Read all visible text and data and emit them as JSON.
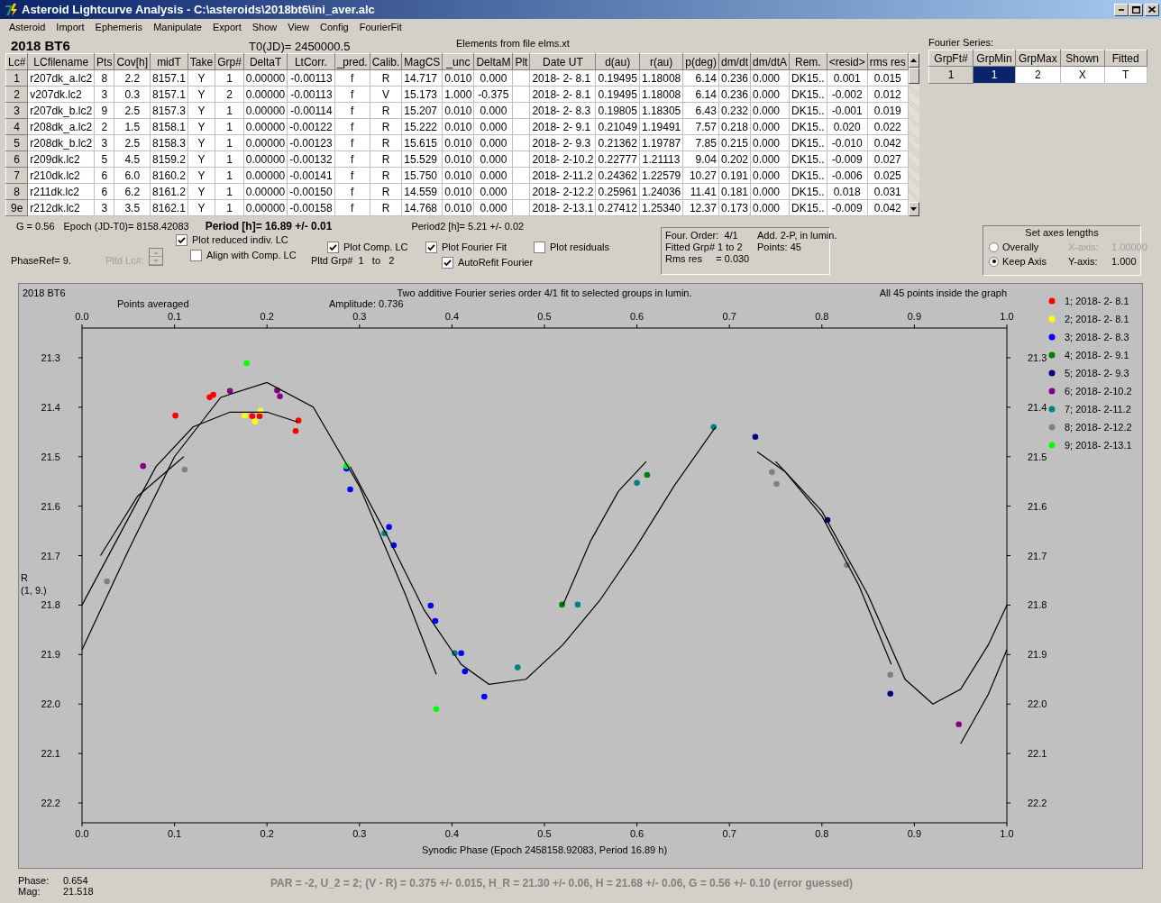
{
  "window": {
    "title": "Asteroid Lightcurve Analysis - C:\\asteroids\\2018bt6\\ini_aver.alc"
  },
  "menu": [
    "Asteroid",
    "Import",
    "Ephemeris",
    "Manipulate",
    "Export",
    "Show",
    "View",
    "Config",
    "FourierFit"
  ],
  "heading": {
    "asteroid": "2018 BT6",
    "t0": "T0(JD)= 2450000.5",
    "elements_note": "Elements from file elms.xt"
  },
  "table": {
    "columns": [
      "Lc#",
      "LCfilename",
      "Pts",
      "Cov[h]",
      "midT",
      "Take",
      "Grp#",
      "DeltaT",
      "LtCorr.",
      "_pred.",
      "Calib.",
      "MagCS",
      "_unc",
      "DeltaM",
      "Plt",
      "Date UT",
      "d(au)",
      "r(au)",
      "p(deg)",
      "dm/dt",
      "dm/dtA",
      "Rem.",
      "<resid>",
      "rms res"
    ],
    "rows": [
      {
        "cells": [
          "1",
          "r207dk_a.lc2",
          "8",
          "2.2",
          "8157.1",
          "Y",
          "1",
          "0.00000",
          "-0.00113",
          "f",
          "R",
          "14.717",
          "0.010",
          "0.000",
          "",
          "2018- 2- 8.1",
          "0.19495",
          "1.18008",
          "6.14",
          "0.236",
          "0.000",
          "DK15..",
          "0.001",
          "0.015"
        ]
      },
      {
        "cells": [
          "2",
          "v207dk.lc2",
          "3",
          "0.3",
          "8157.1",
          "Y",
          "2",
          "0.00000",
          "-0.00113",
          "f",
          "V",
          "15.173",
          "1.000",
          "-0.375",
          "",
          "2018- 2- 8.1",
          "0.19495",
          "1.18008",
          "6.14",
          "0.236",
          "0.000",
          "DK15..",
          "-0.002",
          "0.012"
        ]
      },
      {
        "cells": [
          "3",
          "r207dk_b.lc2",
          "9",
          "2.5",
          "8157.3",
          "Y",
          "1",
          "0.00000",
          "-0.00114",
          "f",
          "R",
          "15.207",
          "0.010",
          "0.000",
          "",
          "2018- 2- 8.3",
          "0.19805",
          "1.18305",
          "6.43",
          "0.232",
          "0.000",
          "DK15..",
          "-0.001",
          "0.019"
        ]
      },
      {
        "cells": [
          "4",
          "r208dk_a.lc2",
          "2",
          "1.5",
          "8158.1",
          "Y",
          "1",
          "0.00000",
          "-0.00122",
          "f",
          "R",
          "15.222",
          "0.010",
          "0.000",
          "",
          "2018- 2- 9.1",
          "0.21049",
          "1.19491",
          "7.57",
          "0.218",
          "0.000",
          "DK15..",
          "0.020",
          "0.022"
        ]
      },
      {
        "cells": [
          "5",
          "r208dk_b.lc2",
          "3",
          "2.5",
          "8158.3",
          "Y",
          "1",
          "0.00000",
          "-0.00123",
          "f",
          "R",
          "15.615",
          "0.010",
          "0.000",
          "",
          "2018- 2- 9.3",
          "0.21362",
          "1.19787",
          "7.85",
          "0.215",
          "0.000",
          "DK15..",
          "-0.010",
          "0.042"
        ]
      },
      {
        "cells": [
          "6",
          "r209dk.lc2",
          "5",
          "4.5",
          "8159.2",
          "Y",
          "1",
          "0.00000",
          "-0.00132",
          "f",
          "R",
          "15.529",
          "0.010",
          "0.000",
          "",
          "2018- 2-10.2",
          "0.22777",
          "1.21113",
          "9.04",
          "0.202",
          "0.000",
          "DK15..",
          "-0.009",
          "0.027"
        ]
      },
      {
        "cells": [
          "7",
          "r210dk.lc2",
          "6",
          "6.0",
          "8160.2",
          "Y",
          "1",
          "0.00000",
          "-0.00141",
          "f",
          "R",
          "15.750",
          "0.010",
          "0.000",
          "",
          "2018- 2-11.2",
          "0.24362",
          "1.22579",
          "10.27",
          "0.191",
          "0.000",
          "DK15..",
          "-0.006",
          "0.025"
        ]
      },
      {
        "cells": [
          "8",
          "r211dk.lc2",
          "6",
          "6.2",
          "8161.2",
          "Y",
          "1",
          "0.00000",
          "-0.00150",
          "f",
          "R",
          "14.559",
          "0.010",
          "0.000",
          "",
          "2018- 2-12.2",
          "0.25961",
          "1.24036",
          "11.41",
          "0.181",
          "0.000",
          "DK15..",
          "0.018",
          "0.031"
        ]
      },
      {
        "cells": [
          "9e",
          "r212dk.lc2",
          "3",
          "3.5",
          "8162.1",
          "Y",
          "1",
          "0.00000",
          "-0.00158",
          "f",
          "R",
          "14.768",
          "0.010",
          "0.000",
          "",
          "2018- 2-13.1",
          "0.27412",
          "1.25340",
          "12.37",
          "0.173",
          "0.000",
          "DK15..",
          "-0.009",
          "0.042"
        ]
      }
    ]
  },
  "fourier_series": {
    "label": "Fourier Series:",
    "columns": [
      "GrpFt#",
      "GrpMin",
      "GrpMax",
      "Shown",
      "Fitted"
    ],
    "rows": [
      {
        "cells": [
          {
            "text": "1",
            "selected": false
          },
          {
            "text": "1",
            "selected": true
          },
          {
            "text": "2",
            "selected": false
          },
          {
            "text": "X",
            "selected": false
          },
          {
            "text": "T",
            "selected": false
          }
        ]
      }
    ]
  },
  "controls": {
    "g": "G = 0.56",
    "epoch": "Epoch (JD-T0)= 8158.42083",
    "period": "Period [h]= 16.89 +/- 0.01",
    "period2": "Period2 [h]= 5.21 +/- 0.02",
    "phase_ref": "PhaseRef= 9.",
    "pltd_lc": {
      "label": "Pltd Lc#:",
      "disabled": true
    },
    "checkboxes": [
      {
        "label": "Plot reduced indiv. LC",
        "checked": true
      },
      {
        "label": "Align with Comp. LC",
        "checked": false
      },
      {
        "label": "Plot Comp. LC",
        "checked": true
      },
      {
        "label": "Plot Fourier Fit",
        "checked": true
      },
      {
        "label": "AutoRefit Fourier",
        "checked": true
      },
      {
        "label": "Plot residuals",
        "checked": false
      }
    ],
    "pltd_grp": "Pltd Grp#  1   to   2"
  },
  "fit_info": [
    "Four. Order:  4/1",
    "Add. 2-P, in lumin.",
    "Fitted Grp# 1 to 2",
    "Points: 45",
    "Rms res     = 0.030"
  ],
  "axes_box": {
    "title": "Set axes lengths",
    "options": [
      {
        "label": "Overally",
        "selected": false,
        "axis_label": "X-axis:",
        "value": "1.00000",
        "disabled": true
      },
      {
        "label": "Keep Axis",
        "selected": true,
        "axis_label": "Y-axis:",
        "value": "1.000",
        "disabled": false
      }
    ]
  },
  "chart": {
    "caption": "2018 BT6",
    "ylabel_note": "(1, 9.)",
    "annotations": [
      {
        "text": "Points averaged",
        "kind": "left"
      },
      {
        "text": "Amplitude: 0.736",
        "kind": "center"
      },
      {
        "text": "All 45 points inside the graph",
        "kind": "right"
      }
    ],
    "chart_data": {
      "type": "scatter",
      "title": "Two additive Fourier series order 4/1 fit to selected groups in lumin.",
      "xlabel": "Synodic Phase (Epoch 2458158.92083, Period 16.89 h)",
      "ylabel": "R",
      "legend": "right",
      "xlim": [
        0,
        1
      ],
      "ylim": [
        22.24,
        21.24
      ],
      "x2lim": [
        0,
        1
      ],
      "y2lim": [
        22.24,
        21.24
      ],
      "xticks": [
        {
          "value": 0,
          "label": "0.0"
        },
        {
          "value": 0.1,
          "label": "0.1"
        },
        {
          "value": 0.2,
          "label": "0.2"
        },
        {
          "value": 0.3,
          "label": "0.3"
        },
        {
          "value": 0.4,
          "label": "0.4"
        },
        {
          "value": 0.5,
          "label": "0.5"
        },
        {
          "value": 0.6,
          "label": "0.6"
        },
        {
          "value": 0.7,
          "label": "0.7"
        },
        {
          "value": 0.8,
          "label": "0.8"
        },
        {
          "value": 0.9,
          "label": "0.9"
        },
        {
          "value": 1,
          "label": "1.0"
        }
      ],
      "x2ticks": [
        {
          "value": 0,
          "label": "0.0"
        },
        {
          "value": 0.1,
          "label": "0.1"
        },
        {
          "value": 0.2,
          "label": "0.2"
        },
        {
          "value": 0.3,
          "label": "0.3"
        },
        {
          "value": 0.4,
          "label": "0.4"
        },
        {
          "value": 0.5,
          "label": "0.5"
        },
        {
          "value": 0.6,
          "label": "0.6"
        },
        {
          "value": 0.7,
          "label": "0.7"
        },
        {
          "value": 0.8,
          "label": "0.8"
        },
        {
          "value": 0.9,
          "label": "0.9"
        },
        {
          "value": 1,
          "label": "1.0"
        }
      ],
      "yticks": [
        {
          "value": 21.3,
          "label": "21.3"
        },
        {
          "value": 21.4,
          "label": "21.4"
        },
        {
          "value": 21.5,
          "label": "21.5"
        },
        {
          "value": 21.6,
          "label": "21.6"
        },
        {
          "value": 21.7,
          "label": "21.7"
        },
        {
          "value": 21.8,
          "label": "21.8"
        },
        {
          "value": 21.9,
          "label": "21.9"
        },
        {
          "value": 22,
          "label": "22.0"
        },
        {
          "value": 22.1,
          "label": "22.1"
        },
        {
          "value": 22.2,
          "label": "22.2"
        }
      ],
      "y2ticks": [
        {
          "value": 21.3,
          "label": "21.3"
        },
        {
          "value": 21.4,
          "label": "21.4"
        },
        {
          "value": 21.5,
          "label": "21.5"
        },
        {
          "value": 21.6,
          "label": "21.6"
        },
        {
          "value": 21.7,
          "label": "21.7"
        },
        {
          "value": 21.8,
          "label": "21.8"
        },
        {
          "value": 21.9,
          "label": "21.9"
        },
        {
          "value": 22,
          "label": "22.0"
        },
        {
          "value": 22.1,
          "label": "22.1"
        },
        {
          "value": 22.2,
          "label": "22.2"
        }
      ],
      "series": [
        {
          "name": "1; 2018- 2- 8.1",
          "color": "#ff0000",
          "x": [
            0.101,
            0.138,
            0.142,
            0.184,
            0.192,
            0.231,
            0.234
          ],
          "values": [
            21.417,
            21.38,
            21.375,
            21.418,
            21.418,
            21.448,
            21.427
          ]
        },
        {
          "name": "2; 2018- 2- 8.1",
          "color": "#ffff00",
          "x": [
            0.176,
            0.187,
            0.193
          ],
          "values": [
            21.417,
            21.429,
            21.407
          ]
        },
        {
          "name": "3; 2018- 2- 8.3",
          "color": "#0000ff",
          "x": [
            0.286,
            0.29,
            0.332,
            0.337,
            0.377,
            0.382,
            0.41,
            0.414,
            0.435
          ],
          "values": [
            21.524,
            21.566,
            21.642,
            21.679,
            21.801,
            21.832,
            21.897,
            21.934,
            21.985
          ]
        },
        {
          "name": "4; 2018- 2- 9.1",
          "color": "#008000",
          "x": [
            0.519,
            0.611
          ],
          "values": [
            21.799,
            21.537
          ]
        },
        {
          "name": "5; 2018- 2- 9.3",
          "color": "#000080",
          "x": [
            0.728,
            0.806,
            0.874
          ],
          "values": [
            21.46,
            21.628,
            21.979
          ]
        },
        {
          "name": "6; 2018- 2-10.2",
          "color": "#800080",
          "x": [
            0.066,
            0.16,
            0.211,
            0.214,
            0.948
          ],
          "values": [
            21.519,
            21.367,
            21.366,
            21.378,
            22.041
          ]
        },
        {
          "name": "7; 2018- 2-11.2",
          "color": "#008080",
          "x": [
            0.327,
            0.403,
            0.471,
            0.536,
            0.6,
            0.683
          ],
          "values": [
            21.655,
            21.897,
            21.926,
            21.799,
            21.553,
            21.44
          ]
        },
        {
          "name": "8; 2018- 2-12.2",
          "color": "#808080",
          "x": [
            0.027,
            0.111,
            0.746,
            0.751,
            0.827,
            0.874
          ],
          "values": [
            21.752,
            21.526,
            21.531,
            21.555,
            21.719,
            21.941
          ]
        },
        {
          "name": "9; 2018- 2-13.1",
          "color": "#00ff00",
          "x": [
            0.178,
            0.286,
            0.383
          ],
          "values": [
            21.311,
            21.519,
            22.01
          ]
        },
        {
          "type": "line",
          "color": "#000000",
          "x": [
            0,
            0.04,
            0.08,
            0.12,
            0.16,
            0.2,
            0.233
          ],
          "values": [
            21.8,
            21.66,
            21.52,
            21.44,
            21.41,
            21.41,
            21.43
          ]
        },
        {
          "type": "line",
          "color": "#000000",
          "x": [
            0,
            0.05,
            0.1,
            0.15,
            0.2,
            0.25,
            0.3,
            0.35,
            0.383
          ],
          "values": [
            21.89,
            21.69,
            21.5,
            21.38,
            21.35,
            21.4,
            21.56,
            21.78,
            21.94
          ]
        },
        {
          "type": "line",
          "color": "#000000",
          "x": [
            0.02,
            0.06,
            0.11
          ],
          "values": [
            21.7,
            21.58,
            21.5
          ]
        },
        {
          "type": "line",
          "color": "#000000",
          "x": [
            0.29,
            0.33,
            0.37,
            0.41,
            0.44,
            0.48,
            0.52,
            0.56,
            0.6,
            0.64,
            0.685
          ],
          "values": [
            21.52,
            21.66,
            21.81,
            21.92,
            21.96,
            21.95,
            21.88,
            21.79,
            21.68,
            21.56,
            21.44
          ]
        },
        {
          "type": "line",
          "color": "#000000",
          "x": [
            0.52,
            0.55,
            0.58,
            0.61
          ],
          "values": [
            21.8,
            21.67,
            21.57,
            21.51
          ]
        },
        {
          "type": "line",
          "color": "#000000",
          "x": [
            0.73,
            0.76,
            0.8,
            0.84,
            0.875
          ],
          "values": [
            21.49,
            21.53,
            21.62,
            21.76,
            21.92
          ]
        },
        {
          "type": "line",
          "color": "#000000",
          "x": [
            0.75,
            0.8,
            0.85,
            0.89,
            0.92,
            0.95,
            0.98,
            1
          ],
          "values": [
            21.51,
            21.61,
            21.78,
            21.95,
            22,
            21.97,
            21.88,
            21.8
          ]
        },
        {
          "type": "line",
          "color": "#000000",
          "x": [
            0.95,
            0.98,
            1
          ],
          "values": [
            22.08,
            21.98,
            21.89
          ]
        }
      ]
    }
  },
  "footer": {
    "readouts": [
      {
        "label": "Phase:",
        "value": "0.654"
      },
      {
        "label": "Mag:",
        "value": "21.518"
      }
    ],
    "status": "PAR = -2, U_2 = 2; (V - R) = 0.375 +/- 0.015, H_R = 21.30 +/- 0.06, H = 21.68 +/- 0.06, G = 0.56 +/- 0.10 (error guessed)"
  }
}
